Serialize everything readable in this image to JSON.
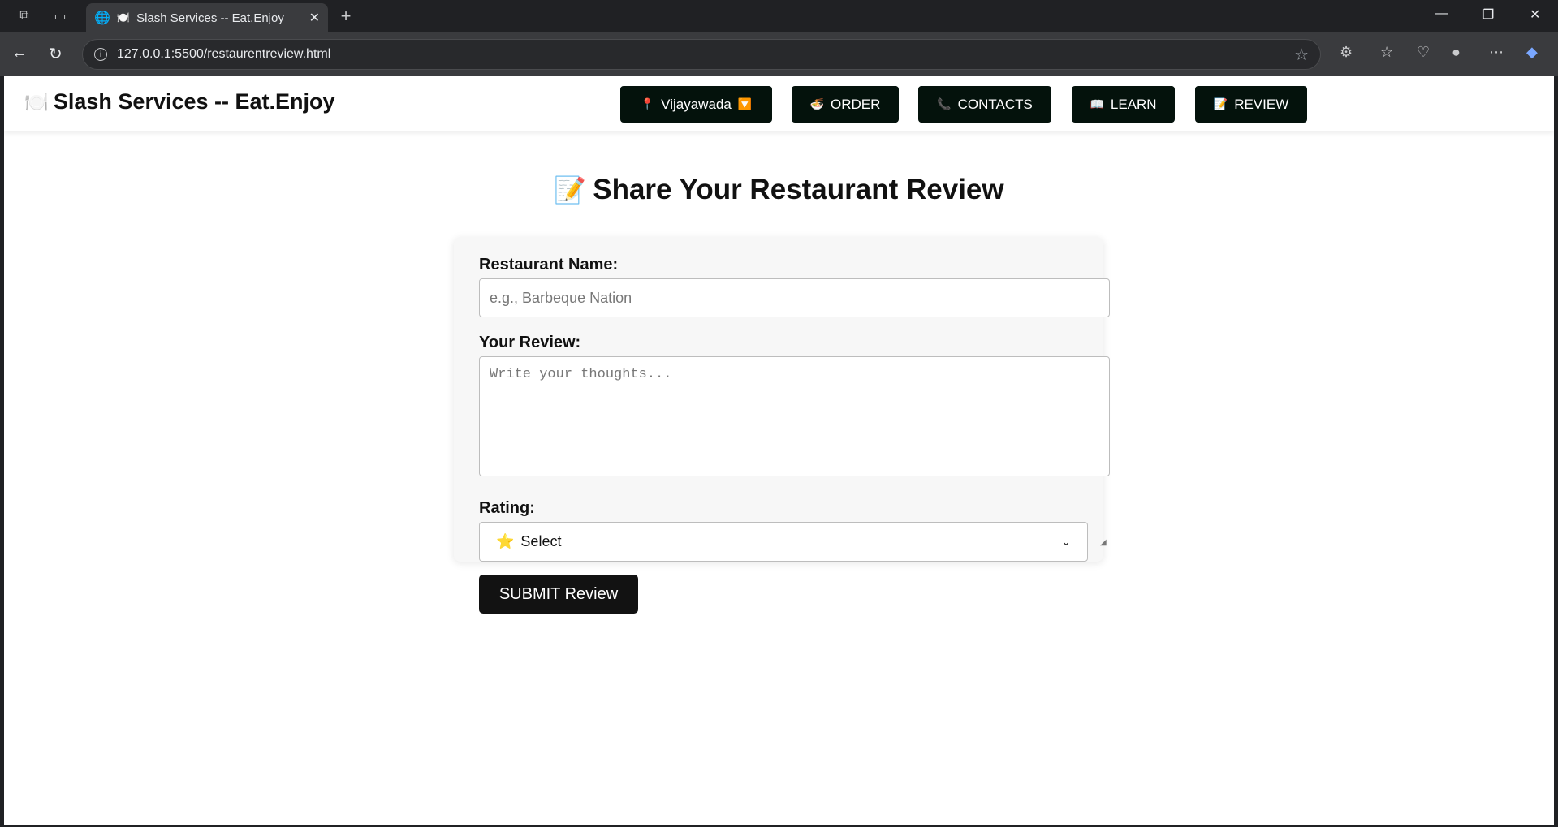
{
  "browser": {
    "tab_title": "Slash Services -- Eat.Enjoy",
    "tab_favicon": "🍽️",
    "url": "127.0.0.1:5500/restaurentreview.html"
  },
  "site": {
    "brand_icon": "🍽️",
    "brand": "Slash Services -- Eat.Enjoy",
    "nav": {
      "location": {
        "icon": "📍",
        "label": "Vijayawada",
        "suffix": "🔽"
      },
      "order": {
        "icon": "🍜",
        "label": "ORDER"
      },
      "contacts": {
        "icon": "📞",
        "label": "CONTACTS"
      },
      "learn": {
        "icon": "📖",
        "label": "LEARN"
      },
      "review": {
        "icon": "📝",
        "label": "REVIEW"
      }
    }
  },
  "page": {
    "heading_icon": "📝",
    "heading": "Share Your Restaurant Review",
    "form": {
      "name_label": "Restaurant Name:",
      "name_placeholder": "e.g., Barbeque Nation",
      "review_label": "Your Review:",
      "review_placeholder": "Write your thoughts...",
      "rating_label": "Rating:",
      "rating_icon": "⭐",
      "rating_selected": "Select",
      "submit_label": "SUBMIT Review"
    }
  }
}
